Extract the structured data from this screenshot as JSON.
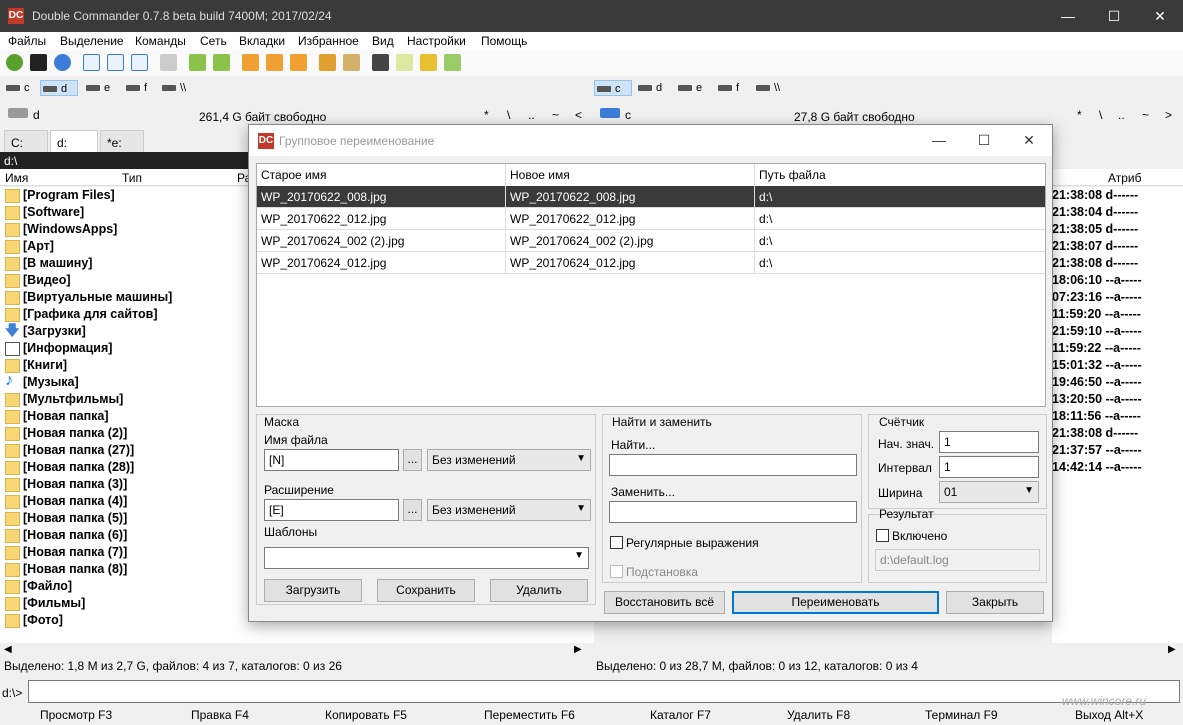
{
  "window": {
    "title": "Double Commander 0.7.8 beta build 7400M; 2017/02/24",
    "logo": "DC"
  },
  "menu": [
    "Файлы",
    "Выделение",
    "Команды",
    "Сеть",
    "Вкладки",
    "Избранное",
    "Вид",
    "Настройки",
    "Помощь"
  ],
  "left": {
    "drives": [
      "c",
      "d",
      "e",
      "f",
      "\\\\"
    ],
    "current_drive": "d",
    "free": "261,4 G байт свободно",
    "nav": [
      "*",
      "\\",
      "..",
      "~",
      "<"
    ],
    "tabs": [
      "C:",
      "d:",
      "*e:"
    ],
    "path": "d:\\",
    "columns": [
      "Имя",
      "Тип",
      "Ра"
    ],
    "files": [
      "[Program Files]",
      "[Software]",
      "[WindowsApps]",
      "[Арт]",
      "[В машину]",
      "[Видео]",
      "[Виртуальные машины]",
      "[Графика для сайтов]",
      "[Загрузки]",
      "[Информация]",
      "[Книги]",
      "[Музыка]",
      "[Мультфильмы]",
      "[Новая папка]",
      "[Новая папка (2)]",
      "[Новая папка (27)]",
      "[Новая папка (28)]",
      "[Новая папка (3)]",
      "[Новая папка (4)]",
      "[Новая папка (5)]",
      "[Новая папка (6)]",
      "[Новая папка (7)]",
      "[Новая папка (8)]",
      "[Файло]",
      "[Фильмы]",
      "[Фото]"
    ],
    "status": "Выделено: 1,8 M из 2,7 G, файлов: 4 из 7, каталогов: 0 из 26"
  },
  "right": {
    "drives": [
      "c",
      "d",
      "e",
      "f",
      "\\\\"
    ],
    "current_drive": "c",
    "free": "27,8 G байт свободно",
    "nav": [
      "*",
      "\\",
      "..",
      "~",
      ">"
    ],
    "attr_header": "Атриб",
    "rows": [
      {
        "time": "21:38:08",
        "attr": "d------"
      },
      {
        "time": "21:38:04",
        "attr": "d------"
      },
      {
        "time": "21:38:05",
        "attr": "d------"
      },
      {
        "time": "21:38:07",
        "attr": "d------"
      },
      {
        "time": "21:38:08",
        "attr": "d------"
      },
      {
        "time": "18:06:10",
        "attr": "--a-----"
      },
      {
        "time": "07:23:16",
        "attr": "--a-----"
      },
      {
        "time": "11:59:20",
        "attr": "--a-----"
      },
      {
        "time": "21:59:10",
        "attr": "--a-----"
      },
      {
        "time": "11:59:22",
        "attr": "--a-----"
      },
      {
        "time": "15:01:32",
        "attr": "--a-----"
      },
      {
        "time": "19:46:50",
        "attr": "--a-----"
      },
      {
        "time": "13:20:50",
        "attr": "--a-----"
      },
      {
        "time": "18:11:56",
        "attr": "--a-----"
      },
      {
        "time": "21:38:08",
        "attr": "d------"
      },
      {
        "time": "21:37:57",
        "attr": "--a-----"
      },
      {
        "time": "14:42:14",
        "attr": "--a-----"
      }
    ],
    "status": "Выделено: 0 из 28,7 M, файлов: 0 из 12, каталогов: 0 из 4"
  },
  "cmdline": {
    "prompt": "d:\\>",
    "value": ""
  },
  "fkeys": [
    "Просмотр F3",
    "Правка F4",
    "Копировать F5",
    "Переместить F6",
    "Каталог F7",
    "Удалить F8",
    "Терминал F9",
    "Выход Alt+X"
  ],
  "watermark": "www.wincore.ru",
  "dialog": {
    "title": "Групповое переименование",
    "columns": [
      "Старое имя",
      "Новое имя",
      "Путь файла"
    ],
    "rows": [
      {
        "old": "WP_20170622_008.jpg",
        "new": "WP_20170622_008.jpg",
        "path": "d:\\"
      },
      {
        "old": "WP_20170622_012.jpg",
        "new": "WP_20170622_012.jpg",
        "path": "d:\\"
      },
      {
        "old": "WP_20170624_002 (2).jpg",
        "new": "WP_20170624_002 (2).jpg",
        "path": "d:\\"
      },
      {
        "old": "WP_20170624_012.jpg",
        "new": "WP_20170624_012.jpg",
        "path": "d:\\"
      }
    ],
    "mask": {
      "legend": "Маска",
      "filename_label": "Имя файла",
      "filename_value": "[N]",
      "filename_case": "Без изменений",
      "ext_label": "Расширение",
      "ext_value": "[E]",
      "ext_case": "Без изменений",
      "dots": "..."
    },
    "templates": {
      "label": "Шаблоны",
      "value": "",
      "load": "Загрузить",
      "save": "Сохранить",
      "delete": "Удалить"
    },
    "find_replace": {
      "legend": "Найти и заменить",
      "find_label": "Найти...",
      "find_value": "",
      "replace_label": "Заменить...",
      "replace_value": "",
      "regex_label": "Регулярные выражения",
      "subst_label": "Подстановка"
    },
    "counter": {
      "legend": "Счётчик",
      "start_label": "Нач. знач.",
      "start_value": "1",
      "interval_label": "Интервал",
      "interval_value": "1",
      "width_label": "Ширина",
      "width_value": "01"
    },
    "result": {
      "legend": "Результат",
      "enabled_label": "Включено",
      "log_path": "d:\\default.log"
    },
    "buttons": {
      "restore": "Восстановить всё",
      "rename": "Переименовать",
      "close": "Закрыть"
    }
  }
}
